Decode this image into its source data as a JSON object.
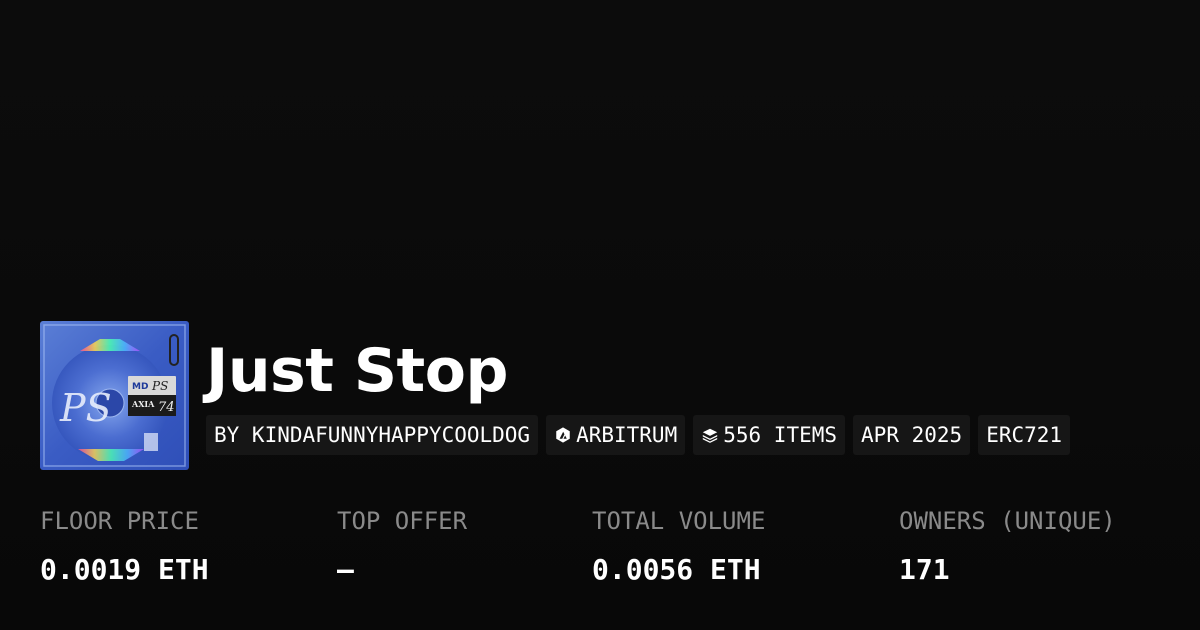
{
  "collection": {
    "title": "Just Stop",
    "thumbnail": {
      "label_md": "MD",
      "label_ps": "PS",
      "label_axia": "AXIA",
      "label_74": "74",
      "logo_text": "PS"
    },
    "tags": [
      {
        "label": "BY KINDAFUNNYHAPPYCOOLDOG",
        "icon": ""
      },
      {
        "label": "ARBITRUM",
        "icon": "arbitrum-icon"
      },
      {
        "label": "556 ITEMS",
        "icon": "layers-icon"
      },
      {
        "label": "APR 2025",
        "icon": ""
      },
      {
        "label": "ERC721",
        "icon": ""
      }
    ]
  },
  "stats": [
    {
      "label": "FLOOR PRICE",
      "value": "0.0019 ETH"
    },
    {
      "label": "TOP OFFER",
      "value": "–"
    },
    {
      "label": "TOTAL VOLUME",
      "value": "0.0056 ETH"
    },
    {
      "label": "OWNERS (UNIQUE)",
      "value": "171"
    }
  ],
  "colors": {
    "background": "#0b0b0b",
    "tag_background": "#161616",
    "label_gray": "#8a8a8a",
    "text": "#ffffff"
  }
}
